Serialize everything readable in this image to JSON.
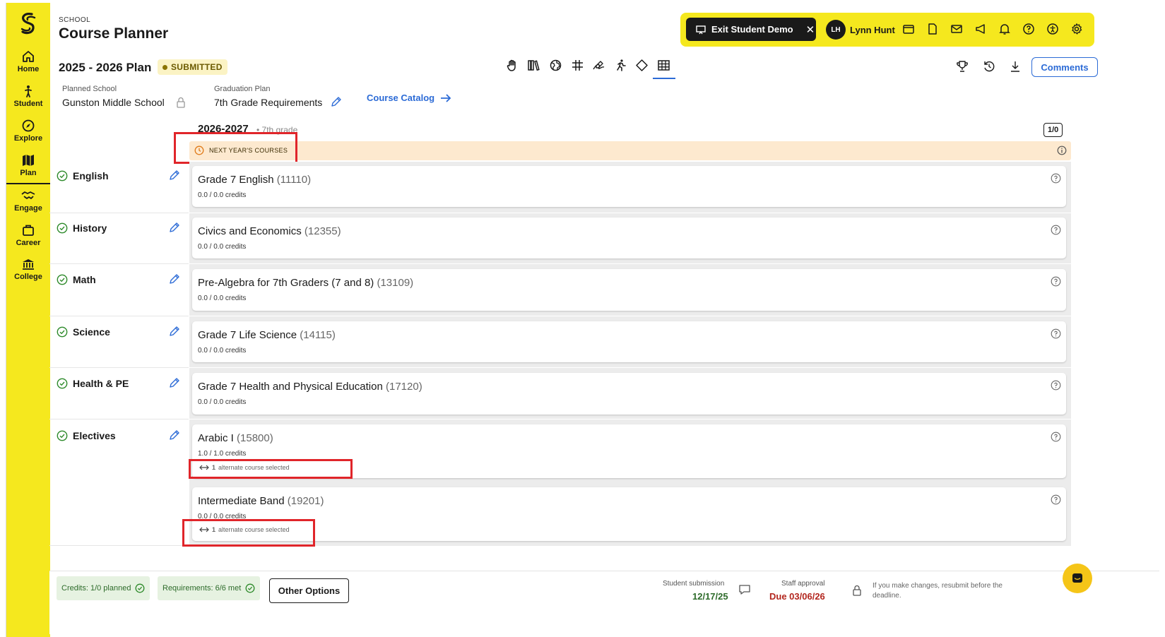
{
  "sidebar": {
    "items": [
      {
        "label": "Home",
        "icon": "home-icon"
      },
      {
        "label": "Student",
        "icon": "student-icon"
      },
      {
        "label": "Explore",
        "icon": "compass-icon"
      },
      {
        "label": "Plan",
        "icon": "map-icon",
        "active": true
      },
      {
        "label": "Engage",
        "icon": "handshake-icon"
      },
      {
        "label": "Career",
        "icon": "briefcase-icon"
      },
      {
        "label": "College",
        "icon": "college-icon"
      }
    ]
  },
  "header": {
    "school_label": "SCHOOL",
    "title": "Course Planner"
  },
  "topbar": {
    "exit_label": "Exit Student Demo",
    "avatar_initials": "LH",
    "user_name": "Lynn Hunt"
  },
  "plan": {
    "title": "2025 - 2026 Plan",
    "status": "SUBMITTED",
    "comments_label": "Comments",
    "planned_school_label": "Planned School",
    "planned_school": "Gunston Middle School",
    "graduation_plan_label": "Graduation Plan",
    "graduation_plan": "7th Grade Requirements",
    "catalog_link": "Course Catalog"
  },
  "year": {
    "title": "2026-2027",
    "separator": "•",
    "grade": "7th grade",
    "counter": "1/0",
    "banner": "NEXT YEAR'S COURSES"
  },
  "subjects": [
    {
      "name": "English",
      "courses": [
        {
          "title": "Grade 7 English",
          "code": "(11110)",
          "credits": "0.0 / 0.0 credits"
        }
      ]
    },
    {
      "name": "History",
      "courses": [
        {
          "title": "Civics and Economics",
          "code": "(12355)",
          "credits": "0.0 / 0.0 credits"
        }
      ]
    },
    {
      "name": "Math",
      "courses": [
        {
          "title": "Pre-Algebra for 7th Graders (7 and 8)",
          "code": "(13109)",
          "credits": "0.0 / 0.0 credits"
        }
      ]
    },
    {
      "name": "Science",
      "courses": [
        {
          "title": "Grade 7 Life Science",
          "code": "(14115)",
          "credits": "0.0 / 0.0 credits"
        }
      ]
    },
    {
      "name": "Health & PE",
      "courses": [
        {
          "title": "Grade 7 Health and Physical Education",
          "code": "(17120)",
          "credits": "0.0 / 0.0 credits"
        }
      ]
    },
    {
      "name": "Electives",
      "courses": [
        {
          "title": "Arabic I",
          "code": "(15800)",
          "credits": "1.0 / 1.0 credits",
          "alt_count": "1",
          "alt_text": "alternate course selected"
        },
        {
          "title": "Intermediate Band",
          "code": "(19201)",
          "credits": "0.0 / 0.0 credits",
          "alt_count": "1",
          "alt_text": "alternate course selected"
        }
      ]
    }
  ],
  "footer": {
    "credits_pill": "Credits: 1/0 planned",
    "requirements_pill": "Requirements: 6/6 met",
    "other_options": "Other Options",
    "student_submission_label": "Student submission",
    "student_submission_date": "12/17/25",
    "staff_approval_label": "Staff approval",
    "staff_approval_due": "Due 03/06/26",
    "resubmit_note": "If you make changes, resubmit before the deadline."
  },
  "colors": {
    "brand_yellow": "#f5e81e",
    "accent_blue": "#2c6bd6",
    "banner_peach": "#fde9cf",
    "success_green": "#2d6b2a",
    "due_red": "#b3261e",
    "highlight_red": "#e0252a"
  }
}
